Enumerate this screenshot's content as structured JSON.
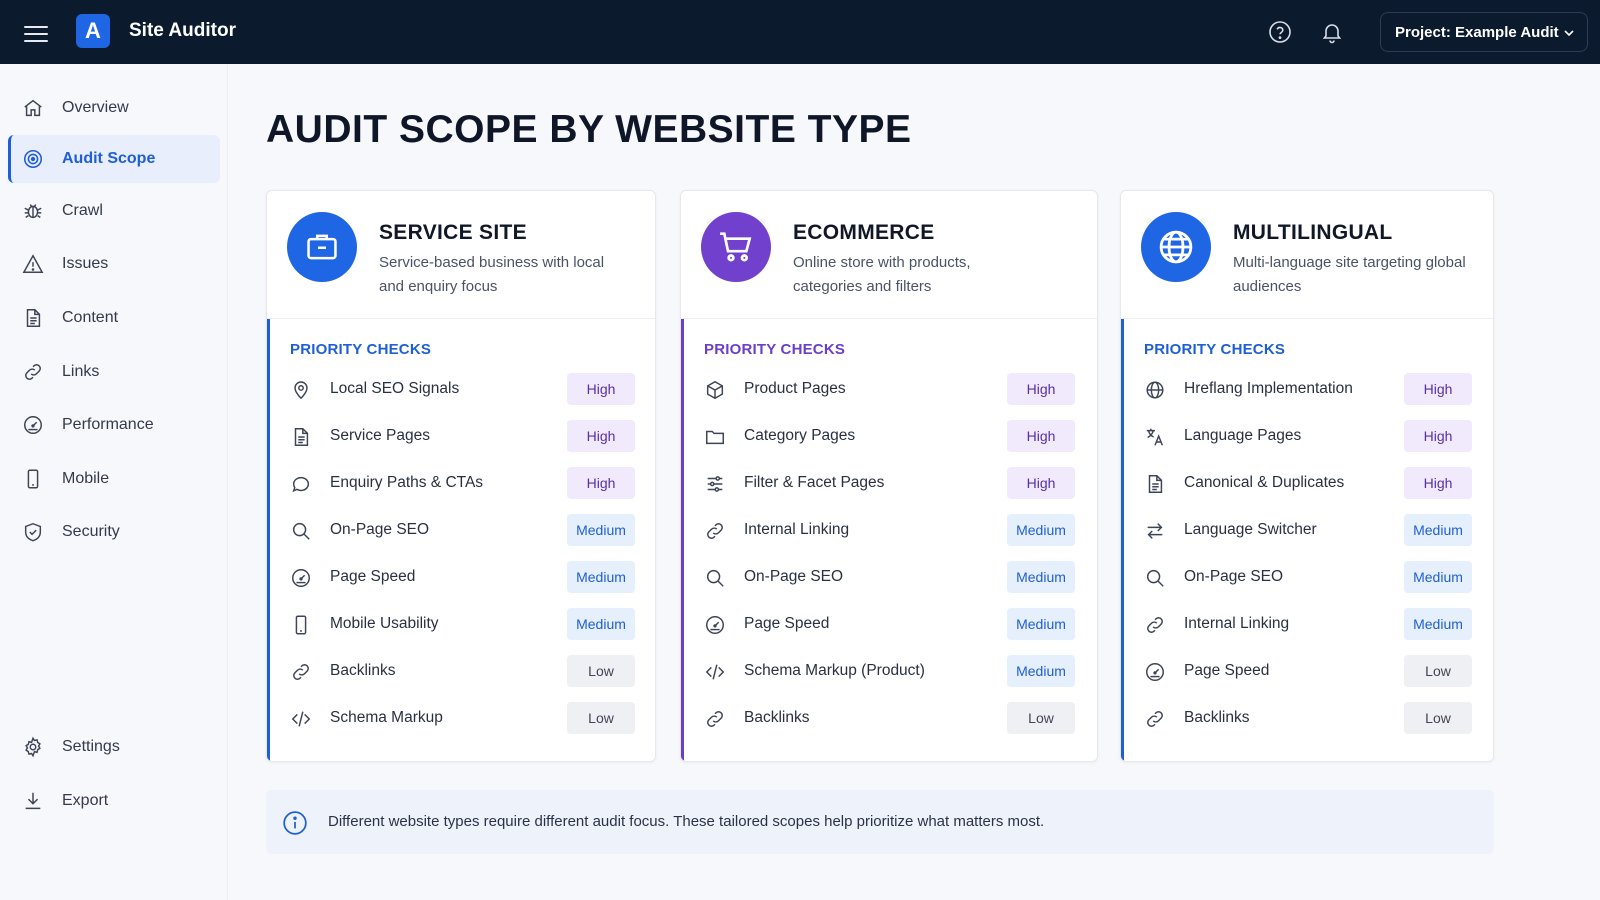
{
  "app": {
    "logo_letter": "A",
    "name": "Site Auditor",
    "project": "Project: Example Audit"
  },
  "sidebar": {
    "items": [
      {
        "label": "Overview",
        "icon": "home-icon"
      },
      {
        "label": "Audit Scope",
        "icon": "target-icon",
        "active": true
      },
      {
        "label": "Crawl",
        "icon": "bug-icon"
      },
      {
        "label": "Issues",
        "icon": "warning-icon"
      },
      {
        "label": "Content",
        "icon": "document-icon"
      },
      {
        "label": "Links",
        "icon": "link-icon"
      },
      {
        "label": "Performance",
        "icon": "gauge-icon"
      },
      {
        "label": "Mobile",
        "icon": "mobile-icon"
      },
      {
        "label": "Security",
        "icon": "shield-icon"
      }
    ],
    "bottom_items": [
      {
        "label": "Settings",
        "icon": "gear-icon"
      },
      {
        "label": "Export",
        "icon": "download-icon"
      }
    ]
  },
  "main": {
    "title": "AUDIT SCOPE BY WEBSITE TYPE",
    "cards": [
      {
        "title": "SERVICE SITE",
        "desc": "Service-based business with local and enquiry focus",
        "icon": "briefcase-icon",
        "accent": "#1f5fd6",
        "priority_label": "PRIORITY CHECKS",
        "checks": [
          {
            "label": "Local SEO Signals",
            "priority": "High",
            "icon": "location-pin-icon"
          },
          {
            "label": "Service Pages",
            "priority": "High",
            "icon": "document-icon"
          },
          {
            "label": "Enquiry Paths & CTAs",
            "priority": "High",
            "icon": "chat-bubble-icon"
          },
          {
            "label": "On-Page SEO",
            "priority": "Medium",
            "icon": "search-icon"
          },
          {
            "label": "Page Speed",
            "priority": "Medium",
            "icon": "gauge-icon"
          },
          {
            "label": "Mobile Usability",
            "priority": "Medium",
            "icon": "mobile-icon"
          },
          {
            "label": "Backlinks",
            "priority": "Low",
            "icon": "link-icon"
          },
          {
            "label": "Schema Markup",
            "priority": "Low",
            "icon": "code-icon"
          }
        ]
      },
      {
        "title": "ECOMMERCE",
        "desc": "Online store with products, categories and filters",
        "icon": "shopping-cart-icon",
        "accent": "#6b3fc8",
        "priority_label": "PRIORITY CHECKS",
        "checks": [
          {
            "label": "Product Pages",
            "priority": "High",
            "icon": "box-icon"
          },
          {
            "label": "Category Pages",
            "priority": "High",
            "icon": "folder-icon"
          },
          {
            "label": "Filter & Facet Pages",
            "priority": "High",
            "icon": "sliders-icon"
          },
          {
            "label": "Internal Linking",
            "priority": "Medium",
            "icon": "link-icon"
          },
          {
            "label": "On-Page SEO",
            "priority": "Medium",
            "icon": "search-icon"
          },
          {
            "label": "Page Speed",
            "priority": "Medium",
            "icon": "gauge-icon"
          },
          {
            "label": "Schema Markup (Product)",
            "priority": "Medium",
            "icon": "code-icon"
          },
          {
            "label": "Backlinks",
            "priority": "Low",
            "icon": "link-icon"
          }
        ]
      },
      {
        "title": "MULTILINGUAL",
        "desc": "Multi-language site targeting global audiences",
        "icon": "globe-icon",
        "accent": "#1f5fd6",
        "priority_label": "PRIORITY CHECKS",
        "checks": [
          {
            "label": "Hreflang Implementation",
            "priority": "High",
            "icon": "globe-icon"
          },
          {
            "label": "Language Pages",
            "priority": "High",
            "icon": "translate-icon"
          },
          {
            "label": "Canonical & Duplicates",
            "priority": "High",
            "icon": "document-icon"
          },
          {
            "label": "Language Switcher",
            "priority": "Medium",
            "icon": "swap-arrows-icon"
          },
          {
            "label": "On-Page SEO",
            "priority": "Medium",
            "icon": "search-icon"
          },
          {
            "label": "Internal Linking",
            "priority": "Medium",
            "icon": "link-icon"
          },
          {
            "label": "Page Speed",
            "priority": "Low",
            "icon": "gauge-icon"
          },
          {
            "label": "Backlinks",
            "priority": "Low",
            "icon": "link-icon"
          }
        ]
      }
    ],
    "info": "Different website types require different audit focus. These tailored scopes help prioritize what matters most."
  },
  "colors": {
    "topbar": "#0c1a2e",
    "primary": "#1f5fd6",
    "ecommerce": "#6b3fc8",
    "page_bg": "#f7f8fb"
  }
}
